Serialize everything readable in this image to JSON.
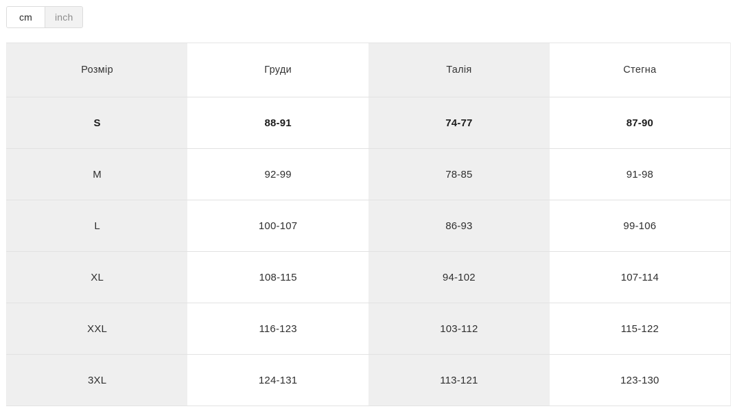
{
  "unit_toggle": {
    "name": "measurement-units",
    "options": [
      {
        "id": "cm",
        "label": "cm",
        "active": true
      },
      {
        "id": "inch",
        "label": "inch",
        "active": false
      }
    ]
  },
  "size_table": {
    "columns": [
      "Розмір",
      "Груди",
      "Талія",
      "Стегна"
    ],
    "rows": [
      {
        "size": "S",
        "chest": "88-91",
        "waist": "74-77",
        "hips": "87-90",
        "highlighted": true
      },
      {
        "size": "M",
        "chest": "92-99",
        "waist": "78-85",
        "hips": "91-98",
        "highlighted": false
      },
      {
        "size": "L",
        "chest": "100-107",
        "waist": "86-93",
        "hips": "99-106",
        "highlighted": false
      },
      {
        "size": "XL",
        "chest": "108-115",
        "waist": "94-102",
        "hips": "107-114",
        "highlighted": false
      },
      {
        "size": "XXL",
        "chest": "116-123",
        "waist": "103-112",
        "hips": "115-122",
        "highlighted": false
      },
      {
        "size": "3XL",
        "chest": "124-131",
        "waist": "113-121",
        "hips": "123-130",
        "highlighted": false
      }
    ]
  },
  "colors": {
    "column_shade": "#efefef",
    "column_plain": "#ffffff",
    "row_border": "#e2e2e2",
    "toggle_border": "#dcdcdc",
    "toggle_inactive_bg": "#f2f2f2",
    "toggle_inactive_text": "#8c8c8c",
    "toggle_active_bg": "#ffffff",
    "toggle_active_text": "#2b2b2b"
  }
}
